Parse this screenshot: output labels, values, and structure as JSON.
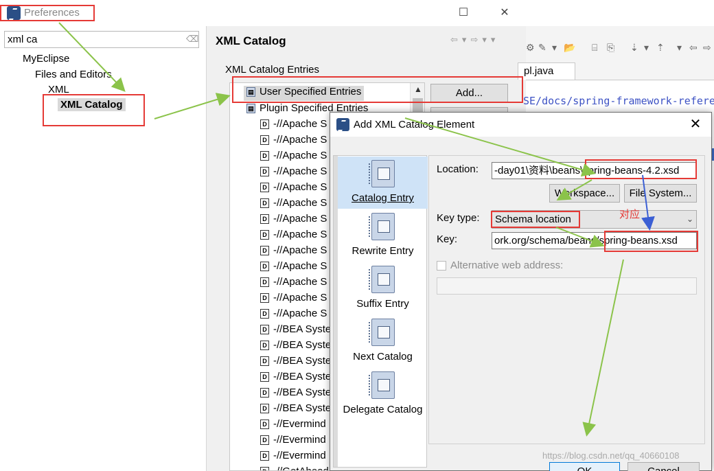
{
  "preferences": {
    "title": "Preferences",
    "filter_value": "xml ca",
    "tree": [
      "MyEclipse",
      "Files and Editors",
      "XML",
      "XML Catalog"
    ],
    "page_title": "XML Catalog",
    "entries_label": "XML Catalog Entries",
    "entries": [
      "User Specified Entries",
      "Plugin Specified Entries",
      "-//Apache S",
      "-//Apache S",
      "-//Apache S",
      "-//Apache S",
      "-//Apache S",
      "-//Apache S",
      "-//Apache S",
      "-//Apache S",
      "-//Apache S",
      "-//Apache S",
      "-//Apache S",
      "-//Apache S",
      "-//Apache S",
      "-//BEA Syste",
      "-//BEA Syste",
      "-//BEA Syste",
      "-//BEA Syste",
      "-//BEA Syste",
      "-//BEA Syste",
      "-//Evermind",
      "-//Evermind",
      "-//Evermind",
      "-//GetAhead"
    ],
    "add_button": "Add..."
  },
  "editor": {
    "tab": "pl.java",
    "link_text": "SE/docs/spring-framework-refere"
  },
  "dialog": {
    "title": "Add XML Catalog Element",
    "close": "✕",
    "list": [
      "Catalog Entry",
      "Rewrite Entry",
      "Suffix Entry",
      "Next Catalog",
      "Delegate Catalog"
    ],
    "location_label": "Location:",
    "location_value": "-day01\\资料\\beans\\spring-beans-4.2.xsd",
    "workspace_button": "Workspace...",
    "filesystem_button": "File System...",
    "keytype_label": "Key type:",
    "keytype_value": "Schema location",
    "key_label": "Key:",
    "key_value": "ork.org/schema/beans/spring-beans.xsd",
    "alt_web_label": "Alternative web address:",
    "ok_button": "OK",
    "cancel_button": "Cancel"
  },
  "annotation": {
    "correspond": "对应"
  },
  "watermark": "https://blog.csdn.net/qq_40660108"
}
